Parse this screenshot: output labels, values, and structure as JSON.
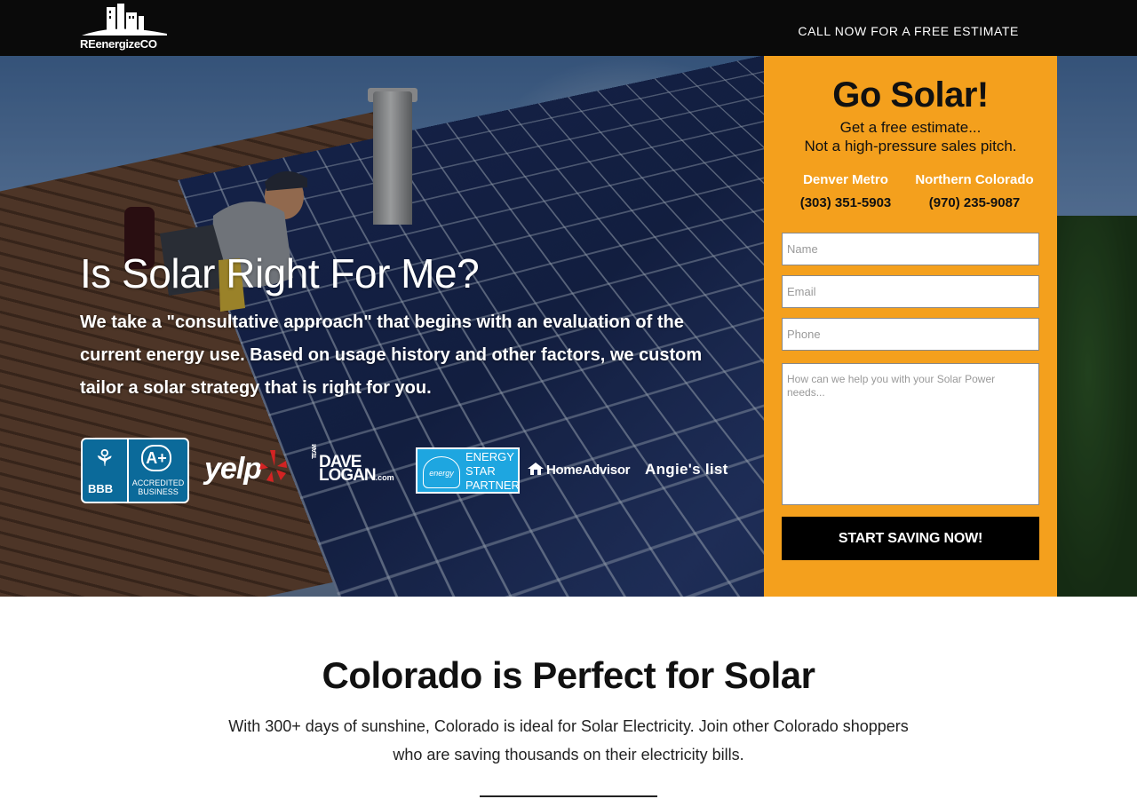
{
  "header": {
    "logo_text": "REenergizeCO",
    "cta": "CALL NOW FOR A FREE ESTIMATE"
  },
  "hero": {
    "headline": "Is Solar Right For Me?",
    "body_pre": "We take a ",
    "body_emphasis": "\"consultative approach\"",
    "body_post": " that begins with an evaluation of the current energy use. Based on usage history and other factors, we custom tailor a solar strategy that is right for you."
  },
  "badges": {
    "bbb_label": "BBB",
    "bbb_grade": "A+",
    "bbb_accredited": "ACCREDITED BUSINESS",
    "yelp": "yelp",
    "dave_team": "TEAM",
    "dave_name1": "DAVE",
    "dave_name2": "LOGAN",
    "dave_suffix": ".com",
    "energy_star_logo": "energy",
    "energy_star": "ENERGY STAR PARTNER",
    "homeadvisor": "HomeAdvisor",
    "angies": "Angie's list"
  },
  "form": {
    "title": "Go Solar!",
    "subtitle1": "Get a free estimate...",
    "subtitle2": "Not a high-pressure sales pitch.",
    "regions": [
      {
        "name": "Denver Metro",
        "phone": "(303) 351-5903"
      },
      {
        "name": "Northern Colorado",
        "phone": "(970) 235-9087"
      }
    ],
    "name_placeholder": "Name",
    "email_placeholder": "Email",
    "phone_placeholder": "Phone",
    "message_placeholder": "How can we help you with your Solar Power needs...",
    "submit_label": "START SAVING NOW!"
  },
  "section": {
    "title": "Colorado is Perfect for Solar",
    "body": "With 300+ days of sunshine, Colorado is ideal for Solar Electricity. Join other Colorado shoppers who are saving thousands on their electricity bills."
  },
  "colors": {
    "header_bg": "#0a0a0a",
    "form_panel": "#f4a01d",
    "submit_bg": "#000000",
    "energy_star_blue": "#1ea6e0",
    "bbb_blue": "#0b6a9a"
  },
  "icons": [
    "company-logo-icon",
    "bbb-torch-icon",
    "yelp-burst-icon",
    "energy-star-icon",
    "homeadvisor-house-icon"
  ]
}
